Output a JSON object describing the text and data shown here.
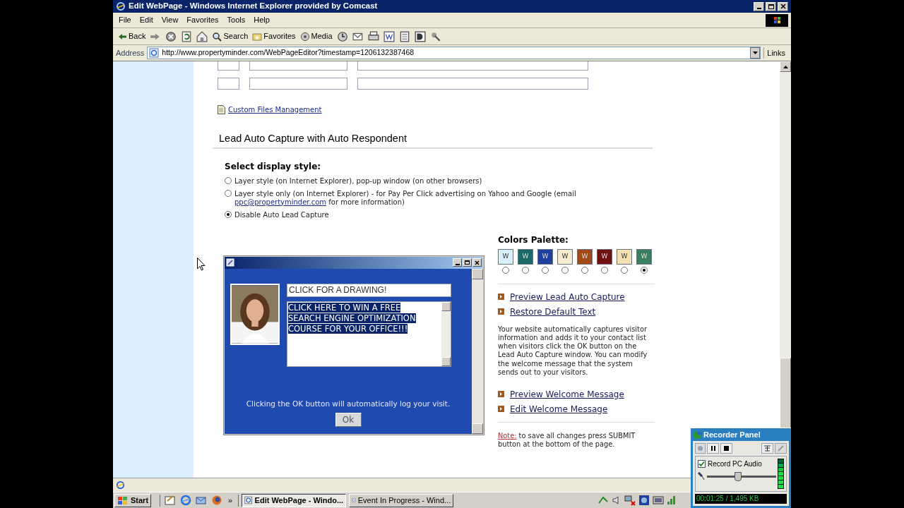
{
  "window": {
    "title": "Edit WebPage - Windows Internet Explorer provided by Comcast"
  },
  "menu": [
    "File",
    "Edit",
    "View",
    "Favorites",
    "Tools",
    "Help"
  ],
  "toolbar": [
    {
      "label": "Back",
      "kind": "back"
    },
    {
      "label": "Search",
      "kind": "search"
    },
    {
      "label": "Favorites",
      "kind": "favorites"
    },
    {
      "label": "Media",
      "kind": "media"
    }
  ],
  "address": {
    "label": "Address",
    "url": "http://www.propertyminder.com/WebPageEditor?timestamp=1206132387468",
    "links": "Links"
  },
  "custom_files_link": "Custom Files Management",
  "section_heading": "Lead Auto Capture with Auto Respondent",
  "display_style": {
    "label": "Select display style:",
    "options": [
      {
        "text": "Layer style (on Internet Explorer), pop-up window (on other browsers)",
        "selected": false
      },
      {
        "text": "Layer style only (on Internet Explorer) - for Pay Per Click advertising on Yahoo and Google (email",
        "link": "ppc@propertyminder.com",
        "text_after": "for more information)",
        "selected": false
      },
      {
        "text": "Disable Auto Lead Capture",
        "selected": true
      }
    ]
  },
  "popup": {
    "headline": "CLICK FOR A DRAWING!",
    "message": "CLICK HERE TO WIN A FREE SEARCH ENGINE OPTIMIZATION COURSE FOR YOUR OFFICE!!!",
    "footer": "Clicking the OK button will automatically log your visit.",
    "ok": "Ok"
  },
  "palette": {
    "label": "Colors Palette:",
    "swatches": [
      {
        "letter": "W",
        "color": "#d8f0fa",
        "selected": false
      },
      {
        "letter": "W",
        "color": "#1a6a6a",
        "selected": false
      },
      {
        "letter": "W",
        "color": "#2040a0",
        "selected": false
      },
      {
        "letter": "W",
        "color": "#f8ecd0",
        "selected": false
      },
      {
        "letter": "W",
        "color": "#a04a18",
        "selected": false
      },
      {
        "letter": "W",
        "color": "#701010",
        "selected": false
      },
      {
        "letter": "W",
        "color": "#f4e0b0",
        "selected": false
      },
      {
        "letter": "W",
        "color": "#3a8060",
        "selected": true
      }
    ]
  },
  "links_top": [
    "Preview Lead Auto Capture",
    "Restore Default Text"
  ],
  "description": "Your website automatically captures visitor information and adds it to your contact list when visitors click the OK button on the Lead Auto Capture window. You can modify the welcome message that the system sends out to your visitors.",
  "links_bottom": [
    "Preview Welcome Message",
    "Edit Welcome Message"
  ],
  "note": {
    "label": "Note:",
    "text": "to save all changes press SUBMIT button at the bottom of the page."
  },
  "recorder": {
    "title": "Recorder Panel",
    "audio_label": "Record PC Audio",
    "audio_checked": true,
    "volume": {
      "level": 0.45
    },
    "time": "00:01:25 / 1,495 KB"
  },
  "taskbar": {
    "start": "Start",
    "more": "»",
    "tasks": [
      {
        "label": "Edit WebPage - Windo...",
        "selected": true
      },
      {
        "label": "Event In Progress - Wind...",
        "selected": false
      }
    ]
  }
}
